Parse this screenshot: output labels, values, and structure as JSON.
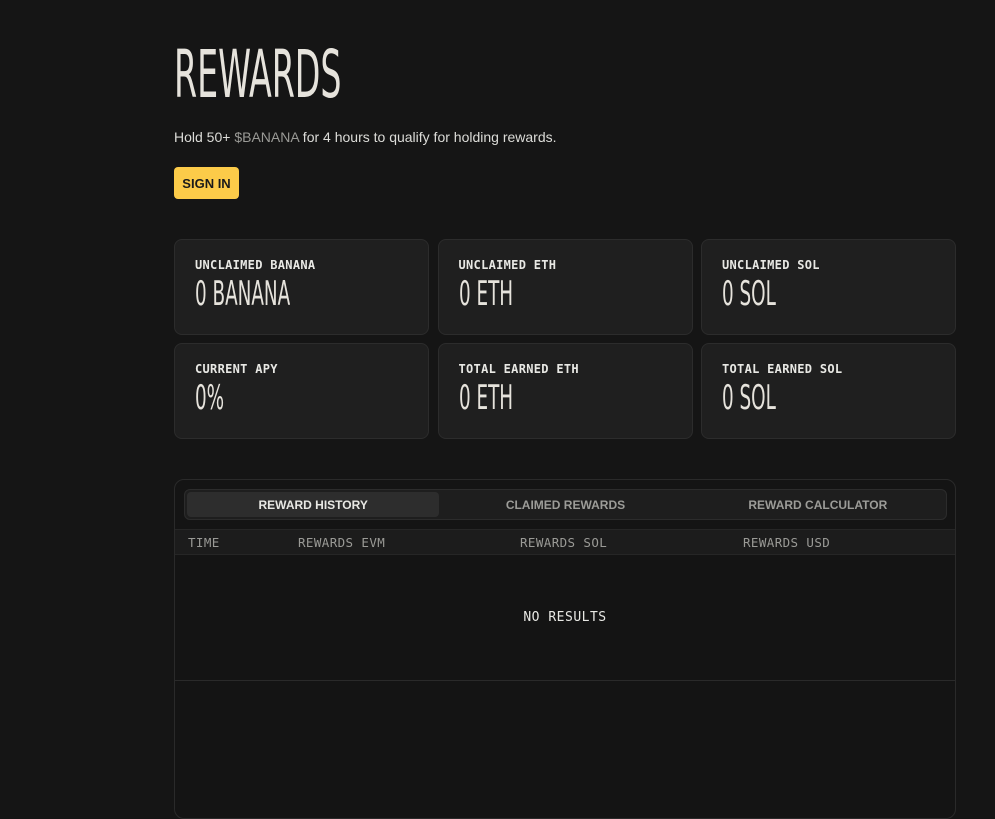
{
  "header": {
    "title": "REWARDS",
    "subtitle_prefix": "Hold 50+ ",
    "subtitle_token": "$BANANA",
    "subtitle_suffix": " for 4 hours to qualify for holding rewards.",
    "signin_label": "SIGN IN"
  },
  "stats": [
    {
      "label": "UNCLAIMED BANANA",
      "value": "0 BANANA"
    },
    {
      "label": "UNCLAIMED ETH",
      "value": "0 ETH"
    },
    {
      "label": "UNCLAIMED SOL",
      "value": "0 SOL"
    },
    {
      "label": "CURRENT APY",
      "value": "0%"
    },
    {
      "label": "TOTAL EARNED ETH",
      "value": "0 ETH"
    },
    {
      "label": "TOTAL EARNED SOL",
      "value": "0 SOL"
    }
  ],
  "tabs": [
    {
      "label": "REWARD HISTORY",
      "active": true
    },
    {
      "label": "CLAIMED REWARDS",
      "active": false
    },
    {
      "label": "REWARD CALCULATOR",
      "active": false
    }
  ],
  "table": {
    "columns": [
      "TIME",
      "REWARDS EVM",
      "REWARDS SOL",
      "REWARDS USD"
    ],
    "empty_text": "NO RESULTS"
  },
  "colors": {
    "background": "#151515",
    "accent": "#fccb49",
    "card": "#1f1f1f"
  }
}
